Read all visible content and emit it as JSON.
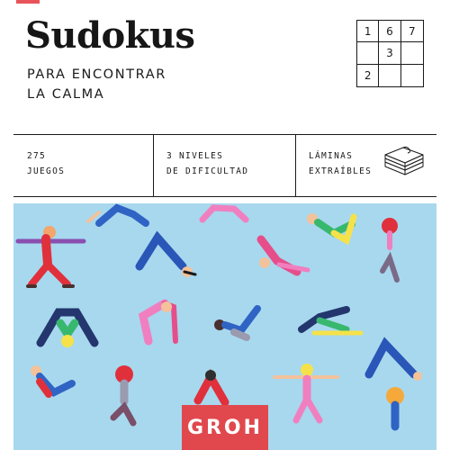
{
  "cover": {
    "title": "Sudokus",
    "subtitle_line1": "PARA ENCONTRAR",
    "subtitle_line2": "LA CALMA"
  },
  "sudoku_grid": [
    [
      "1",
      "6",
      "7"
    ],
    [
      "",
      "3",
      ""
    ],
    [
      "2",
      "",
      ""
    ]
  ],
  "features": {
    "games_line1": "275",
    "games_line2": "JUEGOS",
    "levels_line1": "3 NIVELES",
    "levels_line2": "DE DIFICULTAD",
    "sheets_line1": "LÁMINAS",
    "sheets_line2": "EXTRAÍBLES"
  },
  "publisher": {
    "logo_text": "GROH"
  },
  "colors": {
    "accent": "#e8545a",
    "illustration_background": "#a7d8ee",
    "logo_background": "#e0484d"
  },
  "icons": [
    "notepad-stack-icon"
  ]
}
